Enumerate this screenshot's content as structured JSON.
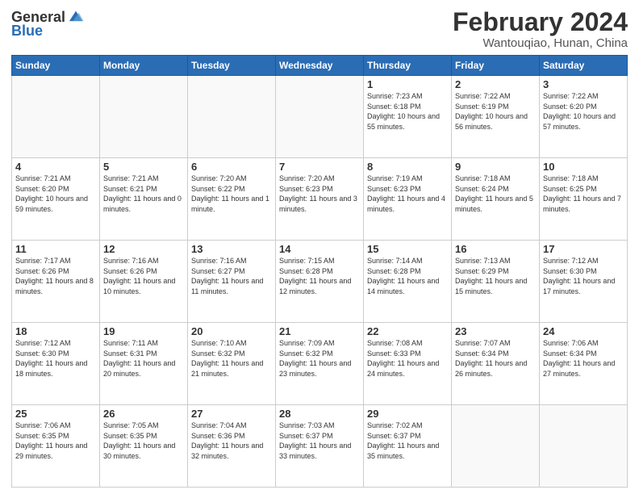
{
  "header": {
    "logo_general": "General",
    "logo_blue": "Blue",
    "month_title": "February 2024",
    "location": "Wantouqiao, Hunan, China"
  },
  "days_of_week": [
    "Sunday",
    "Monday",
    "Tuesday",
    "Wednesday",
    "Thursday",
    "Friday",
    "Saturday"
  ],
  "weeks": [
    [
      {
        "day": "",
        "info": ""
      },
      {
        "day": "",
        "info": ""
      },
      {
        "day": "",
        "info": ""
      },
      {
        "day": "",
        "info": ""
      },
      {
        "day": "1",
        "info": "Sunrise: 7:23 AM\nSunset: 6:18 PM\nDaylight: 10 hours\nand 55 minutes."
      },
      {
        "day": "2",
        "info": "Sunrise: 7:22 AM\nSunset: 6:19 PM\nDaylight: 10 hours\nand 56 minutes."
      },
      {
        "day": "3",
        "info": "Sunrise: 7:22 AM\nSunset: 6:20 PM\nDaylight: 10 hours\nand 57 minutes."
      }
    ],
    [
      {
        "day": "4",
        "info": "Sunrise: 7:21 AM\nSunset: 6:20 PM\nDaylight: 10 hours\nand 59 minutes."
      },
      {
        "day": "5",
        "info": "Sunrise: 7:21 AM\nSunset: 6:21 PM\nDaylight: 11 hours\nand 0 minutes."
      },
      {
        "day": "6",
        "info": "Sunrise: 7:20 AM\nSunset: 6:22 PM\nDaylight: 11 hours\nand 1 minute."
      },
      {
        "day": "7",
        "info": "Sunrise: 7:20 AM\nSunset: 6:23 PM\nDaylight: 11 hours\nand 3 minutes."
      },
      {
        "day": "8",
        "info": "Sunrise: 7:19 AM\nSunset: 6:23 PM\nDaylight: 11 hours\nand 4 minutes."
      },
      {
        "day": "9",
        "info": "Sunrise: 7:18 AM\nSunset: 6:24 PM\nDaylight: 11 hours\nand 5 minutes."
      },
      {
        "day": "10",
        "info": "Sunrise: 7:18 AM\nSunset: 6:25 PM\nDaylight: 11 hours\nand 7 minutes."
      }
    ],
    [
      {
        "day": "11",
        "info": "Sunrise: 7:17 AM\nSunset: 6:26 PM\nDaylight: 11 hours\nand 8 minutes."
      },
      {
        "day": "12",
        "info": "Sunrise: 7:16 AM\nSunset: 6:26 PM\nDaylight: 11 hours\nand 10 minutes."
      },
      {
        "day": "13",
        "info": "Sunrise: 7:16 AM\nSunset: 6:27 PM\nDaylight: 11 hours\nand 11 minutes."
      },
      {
        "day": "14",
        "info": "Sunrise: 7:15 AM\nSunset: 6:28 PM\nDaylight: 11 hours\nand 12 minutes."
      },
      {
        "day": "15",
        "info": "Sunrise: 7:14 AM\nSunset: 6:28 PM\nDaylight: 11 hours\nand 14 minutes."
      },
      {
        "day": "16",
        "info": "Sunrise: 7:13 AM\nSunset: 6:29 PM\nDaylight: 11 hours\nand 15 minutes."
      },
      {
        "day": "17",
        "info": "Sunrise: 7:12 AM\nSunset: 6:30 PM\nDaylight: 11 hours\nand 17 minutes."
      }
    ],
    [
      {
        "day": "18",
        "info": "Sunrise: 7:12 AM\nSunset: 6:30 PM\nDaylight: 11 hours\nand 18 minutes."
      },
      {
        "day": "19",
        "info": "Sunrise: 7:11 AM\nSunset: 6:31 PM\nDaylight: 11 hours\nand 20 minutes."
      },
      {
        "day": "20",
        "info": "Sunrise: 7:10 AM\nSunset: 6:32 PM\nDaylight: 11 hours\nand 21 minutes."
      },
      {
        "day": "21",
        "info": "Sunrise: 7:09 AM\nSunset: 6:32 PM\nDaylight: 11 hours\nand 23 minutes."
      },
      {
        "day": "22",
        "info": "Sunrise: 7:08 AM\nSunset: 6:33 PM\nDaylight: 11 hours\nand 24 minutes."
      },
      {
        "day": "23",
        "info": "Sunrise: 7:07 AM\nSunset: 6:34 PM\nDaylight: 11 hours\nand 26 minutes."
      },
      {
        "day": "24",
        "info": "Sunrise: 7:06 AM\nSunset: 6:34 PM\nDaylight: 11 hours\nand 27 minutes."
      }
    ],
    [
      {
        "day": "25",
        "info": "Sunrise: 7:06 AM\nSunset: 6:35 PM\nDaylight: 11 hours\nand 29 minutes."
      },
      {
        "day": "26",
        "info": "Sunrise: 7:05 AM\nSunset: 6:35 PM\nDaylight: 11 hours\nand 30 minutes."
      },
      {
        "day": "27",
        "info": "Sunrise: 7:04 AM\nSunset: 6:36 PM\nDaylight: 11 hours\nand 32 minutes."
      },
      {
        "day": "28",
        "info": "Sunrise: 7:03 AM\nSunset: 6:37 PM\nDaylight: 11 hours\nand 33 minutes."
      },
      {
        "day": "29",
        "info": "Sunrise: 7:02 AM\nSunset: 6:37 PM\nDaylight: 11 hours\nand 35 minutes."
      },
      {
        "day": "",
        "info": ""
      },
      {
        "day": "",
        "info": ""
      }
    ]
  ]
}
